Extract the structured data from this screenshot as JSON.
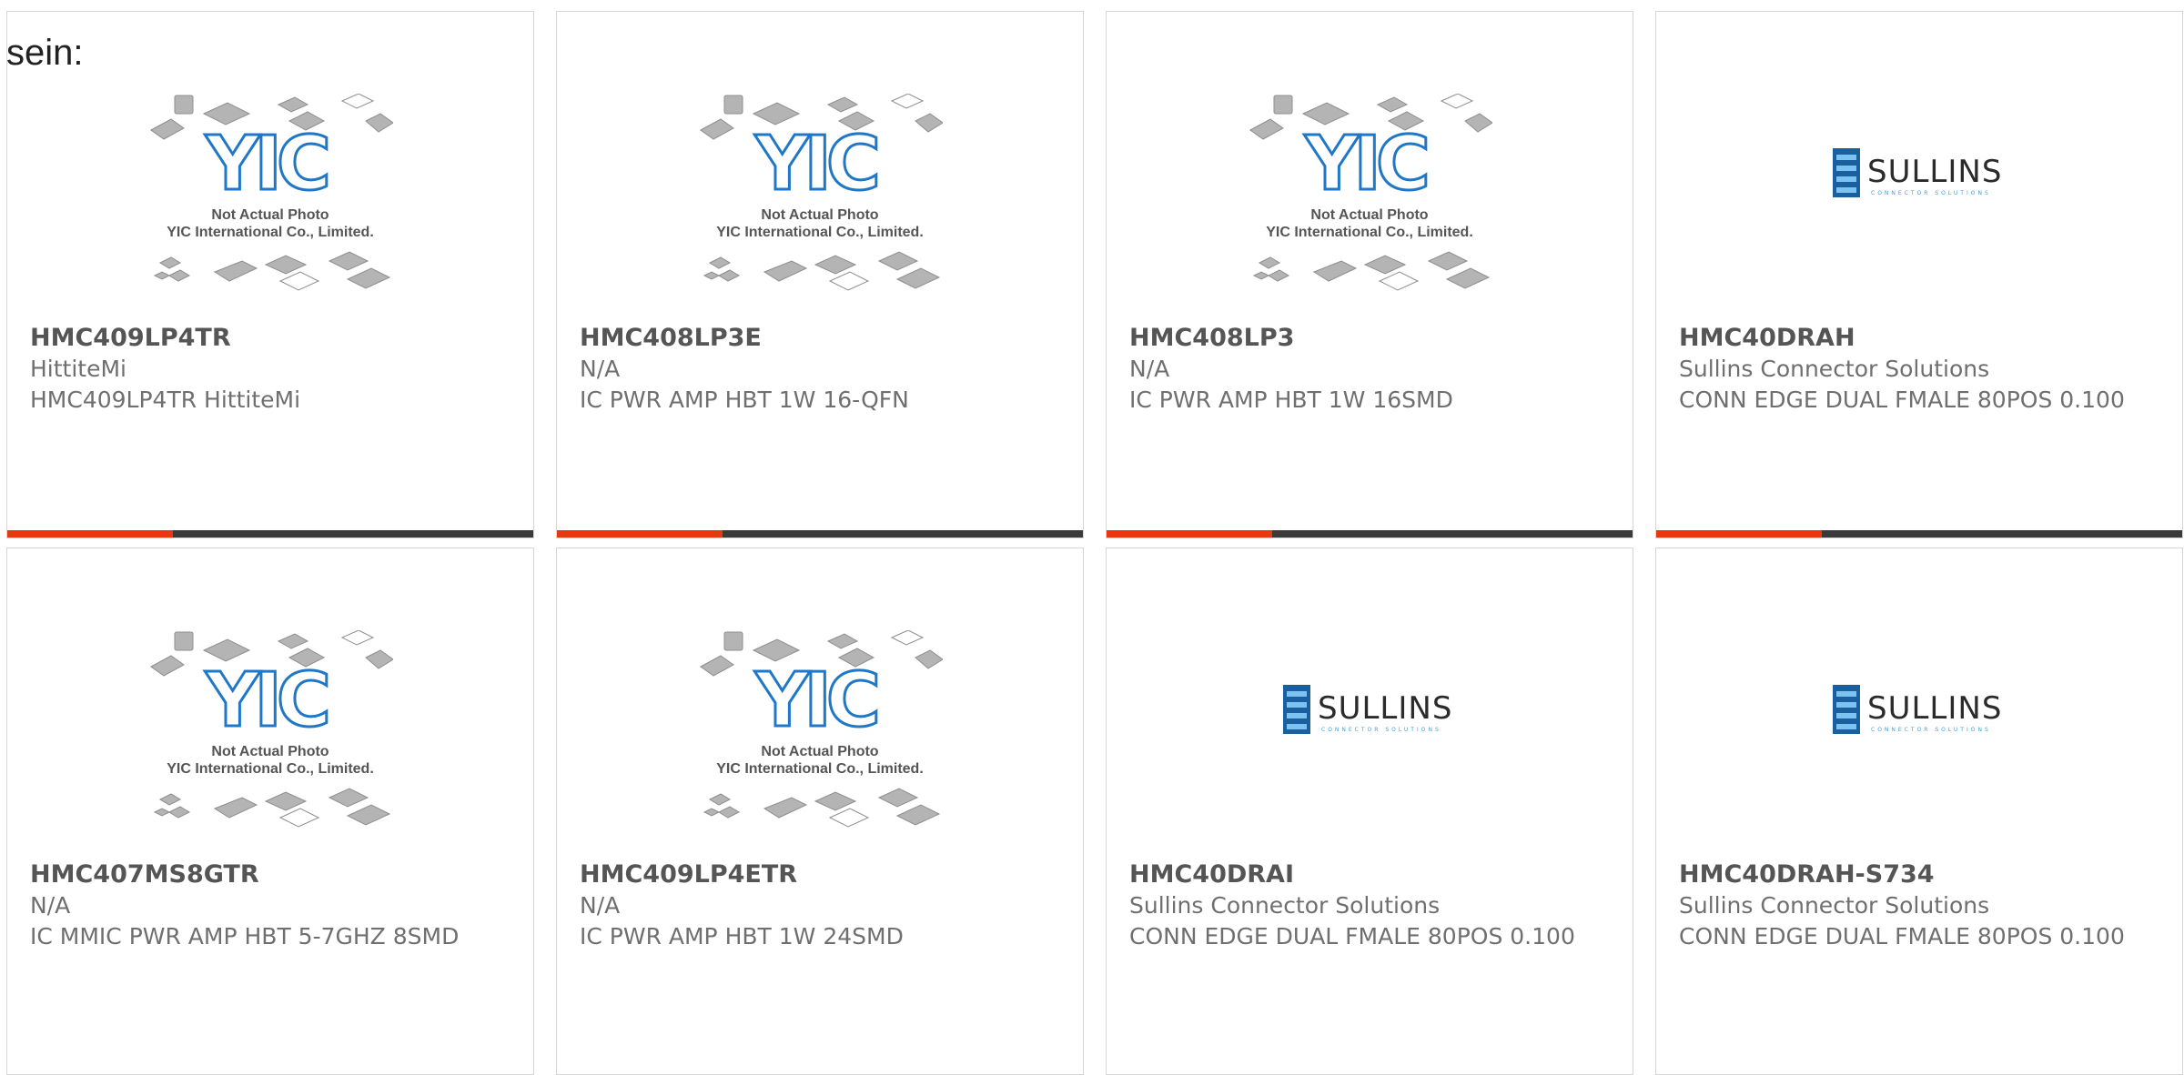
{
  "intro_text": "sein:",
  "colors": {
    "accent": "#e8380d",
    "bar": "#3a3a3a",
    "yic_blue": "#1f77c8",
    "sullins_blue": "#1a5f9e"
  },
  "yic_logo": {
    "brand": "YIC",
    "line1": "Not Actual Photo",
    "line2": "YIC International Co., Limited."
  },
  "sullins_logo": {
    "brand": "SULLINS",
    "tagline": "CONNECTOR SOLUTIONS"
  },
  "products": [
    {
      "part_number": "HMC409LP4TR",
      "manufacturer": "HittiteMi",
      "description": "HMC409LP4TR HittiteMi",
      "image": "yic-placeholder"
    },
    {
      "part_number": "HMC408LP3E",
      "manufacturer": "N/A",
      "description": "IC PWR AMP HBT 1W 16-QFN",
      "image": "yic-placeholder"
    },
    {
      "part_number": "HMC408LP3",
      "manufacturer": "N/A",
      "description": "IC PWR AMP HBT 1W 16SMD",
      "image": "yic-placeholder"
    },
    {
      "part_number": "HMC40DRAH",
      "manufacturer": "Sullins Connector Solutions",
      "description": "CONN EDGE DUAL FMALE 80POS 0.100",
      "image": "sullins-logo"
    },
    {
      "part_number": "HMC407MS8GTR",
      "manufacturer": "N/A",
      "description": "IC MMIC PWR AMP HBT 5-7GHZ 8SMD",
      "image": "yic-placeholder"
    },
    {
      "part_number": "HMC409LP4ETR",
      "manufacturer": "N/A",
      "description": "IC PWR AMP HBT 1W 24SMD",
      "image": "yic-placeholder"
    },
    {
      "part_number": "HMC40DRAI",
      "manufacturer": "Sullins Connector Solutions",
      "description": "CONN EDGE DUAL FMALE 80POS 0.100",
      "image": "sullins-logo"
    },
    {
      "part_number": "HMC40DRAH-S734",
      "manufacturer": "Sullins Connector Solutions",
      "description": "CONN EDGE DUAL FMALE 80POS 0.100",
      "image": "sullins-logo"
    }
  ]
}
